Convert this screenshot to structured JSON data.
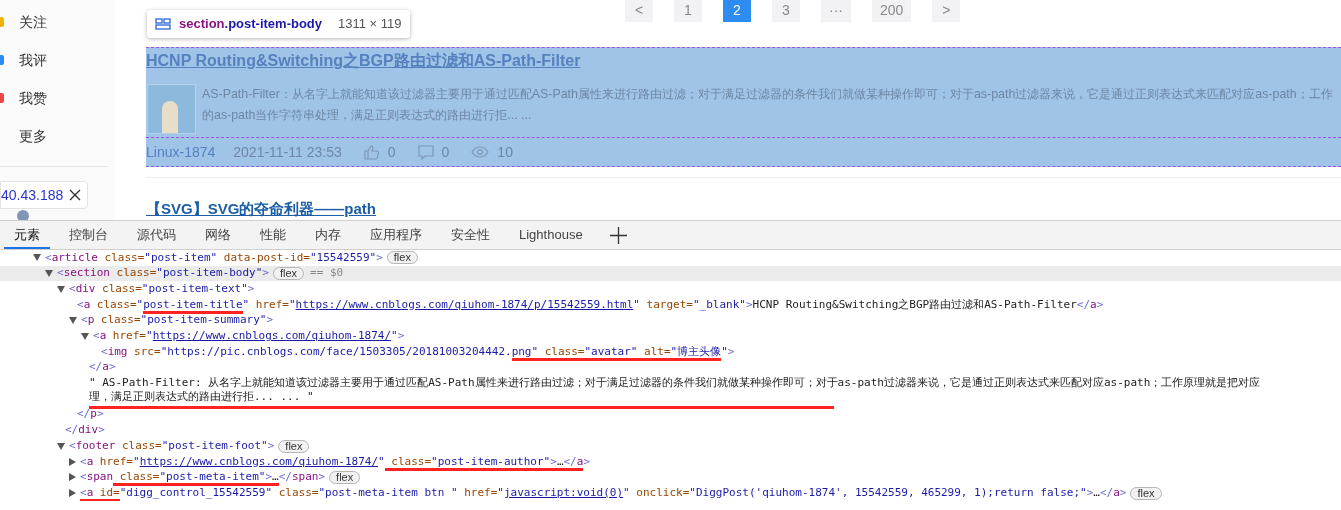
{
  "sidebar": {
    "items": [
      {
        "label": "关注",
        "color": "#f2b400"
      },
      {
        "label": "我评",
        "color": "#2d8cf0"
      },
      {
        "label": "我赞",
        "color": "#ef4444"
      },
      {
        "label": "更多"
      }
    ],
    "ip_chip": {
      "text": "40.43.188"
    }
  },
  "pagination": [
    {
      "label": "<",
      "selected": false
    },
    {
      "label": "1",
      "selected": false
    },
    {
      "label": "2",
      "selected": true
    },
    {
      "label": "3",
      "selected": false
    },
    {
      "label": "···",
      "selected": false
    },
    {
      "label": "200",
      "selected": false
    },
    {
      "label": ">",
      "selected": false
    }
  ],
  "inspector_tooltip": {
    "tag": "section",
    "class": ".post-item-body",
    "size": "1311 × 119"
  },
  "post": {
    "highlighted": true,
    "title": "HCNP Routing&Switching之BGP路由过滤和AS-Path-Filter",
    "summary": [
      "AS-Path-Filter：从名字上就能知道该过滤器主要用于通过匹配AS-Path属性来进行路由过滤；对于满足过滤器的条件我们就做某种操作即可；对于as-path过滤器来说，它是通过正则表达式来匹配对应as-path；工作",
      "的as-path当作字符串处理，满足正则表达式的路由进行拒... ..."
    ],
    "author": "Linux-1874",
    "date": "2021-11-11 23:53",
    "likes": "0",
    "comments": "0",
    "views": "10"
  },
  "next_post": {
    "title": "【SVG】SVG的夺命利器——path"
  },
  "devtools": {
    "tabs": [
      {
        "label": "元素",
        "selected": true
      },
      {
        "label": "控制台",
        "selected": false
      },
      {
        "label": "源代码",
        "selected": false
      },
      {
        "label": "网络",
        "selected": false
      },
      {
        "label": "性能",
        "selected": false
      },
      {
        "label": "内存",
        "selected": false
      },
      {
        "label": "应用程序",
        "selected": false
      },
      {
        "label": "安全性",
        "selected": false
      },
      {
        "label": "Lighthouse",
        "selected": false
      }
    ],
    "dom_tree": [
      {
        "kind": "branch",
        "expanded": true,
        "selected": false,
        "segments": [
          {
            "kind": "bracket",
            "text": "<"
          },
          {
            "kind": "tag",
            "text": "article"
          },
          {
            "kind": "attr",
            "text": " class="
          },
          {
            "kind": "value",
            "text": "\"post-item\""
          },
          {
            "kind": "attr",
            "text": " data-post-id="
          },
          {
            "kind": "value",
            "text": "\"15542559\""
          },
          {
            "kind": "bracket",
            "text": ">"
          }
        ],
        "badges": [
          "flex"
        ],
        "children": [
          {
            "kind": "branch",
            "expanded": true,
            "selected": true,
            "segments": [
              {
                "kind": "bracket",
                "text": "<"
              },
              {
                "kind": "tag",
                "text": "section"
              },
              {
                "kind": "attr",
                "text": " class="
              },
              {
                "kind": "value",
                "text": "\"post-item-body\""
              },
              {
                "kind": "bracket",
                "text": ">"
              }
            ],
            "badges": [
              "flex"
            ],
            "note": "== $0",
            "children": [
              {
                "kind": "branch",
                "expanded": true,
                "selected": false,
                "segments": [
                  {
                    "kind": "bracket",
                    "text": "<"
                  },
                  {
                    "kind": "tag",
                    "text": "div"
                  },
                  {
                    "kind": "attr",
                    "text": " class="
                  },
                  {
                    "kind": "value",
                    "text": "\"post-item-text\""
                  },
                  {
                    "kind": "bracket",
                    "text": ">"
                  }
                ],
                "children": [
                  {
                    "kind": "leaf",
                    "selected": false,
                    "segments": [
                      {
                        "kind": "bracket",
                        "text": "<"
                      },
                      {
                        "kind": "tag",
                        "text": "a"
                      },
                      {
                        "kind": "attr",
                        "text": " class="
                      },
                      {
                        "kind": "value",
                        "text": "\""
                      },
                      {
                        "kind": "value",
                        "text": "post-item-title",
                        "underlined": true
                      },
                      {
                        "kind": "value",
                        "text": "\""
                      },
                      {
                        "kind": "attr",
                        "text": " href="
                      },
                      {
                        "kind": "value",
                        "text": "\""
                      },
                      {
                        "kind": "link",
                        "text": "https://www.cnblogs.com/qiuhom-1874/p/15542559.html"
                      },
                      {
                        "kind": "value",
                        "text": "\""
                      },
                      {
                        "kind": "attr",
                        "text": " target="
                      },
                      {
                        "kind": "value",
                        "text": "\"_blank\""
                      },
                      {
                        "kind": "bracket",
                        "text": ">"
                      },
                      {
                        "kind": "text",
                        "text": "HCNP Routing&Switching之BGP路由过滤和AS-Path-Filter"
                      },
                      {
                        "kind": "bracket",
                        "text": "</"
                      },
                      {
                        "kind": "tag",
                        "text": "a"
                      },
                      {
                        "kind": "bracket",
                        "text": ">"
                      }
                    ]
                  },
                  {
                    "kind": "branch",
                    "expanded": true,
                    "selected": false,
                    "segments": [
                      {
                        "kind": "bracket",
                        "text": "<"
                      },
                      {
                        "kind": "tag",
                        "text": "p"
                      },
                      {
                        "kind": "attr",
                        "text": " class="
                      },
                      {
                        "kind": "value",
                        "text": "\"post-item-summary\""
                      },
                      {
                        "kind": "bracket",
                        "text": ">"
                      }
                    ],
                    "children": [
                      {
                        "kind": "branch",
                        "expanded": true,
                        "selected": false,
                        "segments": [
                          {
                            "kind": "bracket",
                            "text": "<"
                          },
                          {
                            "kind": "tag",
                            "text": "a"
                          },
                          {
                            "kind": "attr",
                            "text": " href="
                          },
                          {
                            "kind": "value",
                            "text": "\""
                          },
                          {
                            "kind": "link",
                            "text": "https://www.cnblogs.com/qiuhom-1874/"
                          },
                          {
                            "kind": "value",
                            "text": "\""
                          },
                          {
                            "kind": "bracket",
                            "text": ">"
                          }
                        ],
                        "children": [
                          {
                            "kind": "leaf",
                            "selected": false,
                            "segments": [
                              {
                                "kind": "bracket",
                                "text": "<"
                              },
                              {
                                "kind": "tag",
                                "text": "img"
                              },
                              {
                                "kind": "attr",
                                "text": " src="
                              },
                              {
                                "kind": "value",
                                "text": "\"https://pic.cnblogs.com/face/1503305/20181003204442."
                              },
                              {
                                "kind": "value",
                                "text": "png\"",
                                "underlined": true
                              },
                              {
                                "kind": "attr",
                                "text": " class=",
                                "underlined": true
                              },
                              {
                                "kind": "value",
                                "text": "\"avatar\"",
                                "underlined": true
                              },
                              {
                                "kind": "attr",
                                "text": " alt=",
                                "underlined": true
                              },
                              {
                                "kind": "value",
                                "text": "\"博主头像",
                                "underlined": true
                              },
                              {
                                "kind": "value",
                                "text": "\""
                              },
                              {
                                "kind": "bracket",
                                "text": ">"
                              }
                            ]
                          }
                        ],
                        "closing": [
                          {
                            "kind": "bracket",
                            "text": "</"
                          },
                          {
                            "kind": "tag",
                            "text": "a"
                          },
                          {
                            "kind": "bracket",
                            "text": ">"
                          }
                        ]
                      },
                      {
                        "kind": "text",
                        "selected": false,
                        "lines": [
                          "\" AS-Path-Filter: 从名字上就能知道该过滤器主要用于通过匹配AS-Path属性来进行路由过滤；对于满足过滤器的条件我们就做某种操作即可；对于as-path过滤器来说，它是通过正则表达式来匹配对应as-path；工作原理就是把对应",
                          "理，满足正则表达式的路由进行拒... ... \""
                        ],
                        "underlined": true
                      }
                    ],
                    "closing": [
                      {
                        "kind": "bracket",
                        "text": "</"
                      },
                      {
                        "kind": "tag",
                        "text": "p"
                      },
                      {
                        "kind": "bracket",
                        "text": ">"
                      }
                    ]
                  }
                ],
                "closing": [
                  {
                    "kind": "bracket",
                    "text": "</"
                  },
                  {
                    "kind": "tag",
                    "text": "div"
                  },
                  {
                    "kind": "bracket",
                    "text": ">"
                  }
                ]
              },
              {
                "kind": "branch",
                "expanded": true,
                "selected": false,
                "segments": [
                  {
                    "kind": "bracket",
                    "text": "<"
                  },
                  {
                    "kind": "tag",
                    "text": "footer"
                  },
                  {
                    "kind": "attr",
                    "text": " class="
                  },
                  {
                    "kind": "value",
                    "text": "\"post-item-foot\""
                  },
                  {
                    "kind": "bracket",
                    "text": ">"
                  }
                ],
                "badges": [
                  "flex"
                ],
                "children": [
                  {
                    "kind": "branch",
                    "expanded": false,
                    "selected": false,
                    "segments": [
                      {
                        "kind": "bracket",
                        "text": "<"
                      },
                      {
                        "kind": "tag",
                        "text": "a"
                      },
                      {
                        "kind": "attr",
                        "text": " href="
                      },
                      {
                        "kind": "value",
                        "text": "\""
                      },
                      {
                        "kind": "link",
                        "text": "https://www.cnblogs.com/qiuhom-1874/"
                      },
                      {
                        "kind": "value",
                        "text": "\""
                      },
                      {
                        "kind": "attr",
                        "text": " class=",
                        "underlined": true
                      },
                      {
                        "kind": "value",
                        "text": "\"post-item-author\"",
                        "underlined": true
                      },
                      {
                        "kind": "bracket",
                        "text": ">",
                        "underlined": true
                      },
                      {
                        "kind": "text",
                        "text": "…",
                        "underlined": true
                      },
                      {
                        "kind": "bracket",
                        "text": "</",
                        "underlined": true
                      },
                      {
                        "kind": "tag",
                        "text": "a",
                        "underlined": true
                      },
                      {
                        "kind": "bracket",
                        "text": ">"
                      }
                    ]
                  },
                  {
                    "kind": "branch",
                    "expanded": false,
                    "selected": false,
                    "segments": [
                      {
                        "kind": "bracket",
                        "text": "<"
                      },
                      {
                        "kind": "tag",
                        "text": "span"
                      },
                      {
                        "kind": "attr",
                        "text": " class=",
                        "underlined": true
                      },
                      {
                        "kind": "value",
                        "text": "\"post-meta-item\"",
                        "underlined": true
                      },
                      {
                        "kind": "bracket",
                        "text": ">",
                        "underlined": true
                      },
                      {
                        "kind": "text",
                        "text": "…",
                        "underlined": true
                      },
                      {
                        "kind": "bracket",
                        "text": "</"
                      },
                      {
                        "kind": "tag",
                        "text": "span"
                      },
                      {
                        "kind": "bracket",
                        "text": ">"
                      }
                    ],
                    "badges": [
                      "flex"
                    ]
                  },
                  {
                    "kind": "branch",
                    "expanded": false,
                    "selected": false,
                    "segments": [
                      {
                        "kind": "bracket",
                        "text": "<",
                        "underlined": true
                      },
                      {
                        "kind": "tag",
                        "text": "a",
                        "underlined": true
                      },
                      {
                        "kind": "attr",
                        "text": " id=",
                        "underlined": true
                      },
                      {
                        "kind": "value",
                        "text": "\"digg_control_15542559\""
                      },
                      {
                        "kind": "attr",
                        "text": " class="
                      },
                      {
                        "kind": "value",
                        "text": "\"post-meta-item btn \""
                      },
                      {
                        "kind": "attr",
                        "text": " href="
                      },
                      {
                        "kind": "value",
                        "text": "\""
                      },
                      {
                        "kind": "link",
                        "text": "javascript:void(0)"
                      },
                      {
                        "kind": "value",
                        "text": "\""
                      },
                      {
                        "kind": "attr",
                        "text": " onclick="
                      },
                      {
                        "kind": "value",
                        "text": "\"DiggPost('qiuhom-1874', 15542559, 465299, 1);return false;\""
                      },
                      {
                        "kind": "bracket",
                        "text": ">"
                      },
                      {
                        "kind": "text",
                        "text": "…"
                      },
                      {
                        "kind": "bracket",
                        "text": "</"
                      },
                      {
                        "kind": "tag",
                        "text": "a"
                      },
                      {
                        "kind": "bracket",
                        "text": ">"
                      }
                    ],
                    "badges": [
                      "flex"
                    ]
                  }
                ]
              }
            ]
          }
        ]
      }
    ]
  }
}
